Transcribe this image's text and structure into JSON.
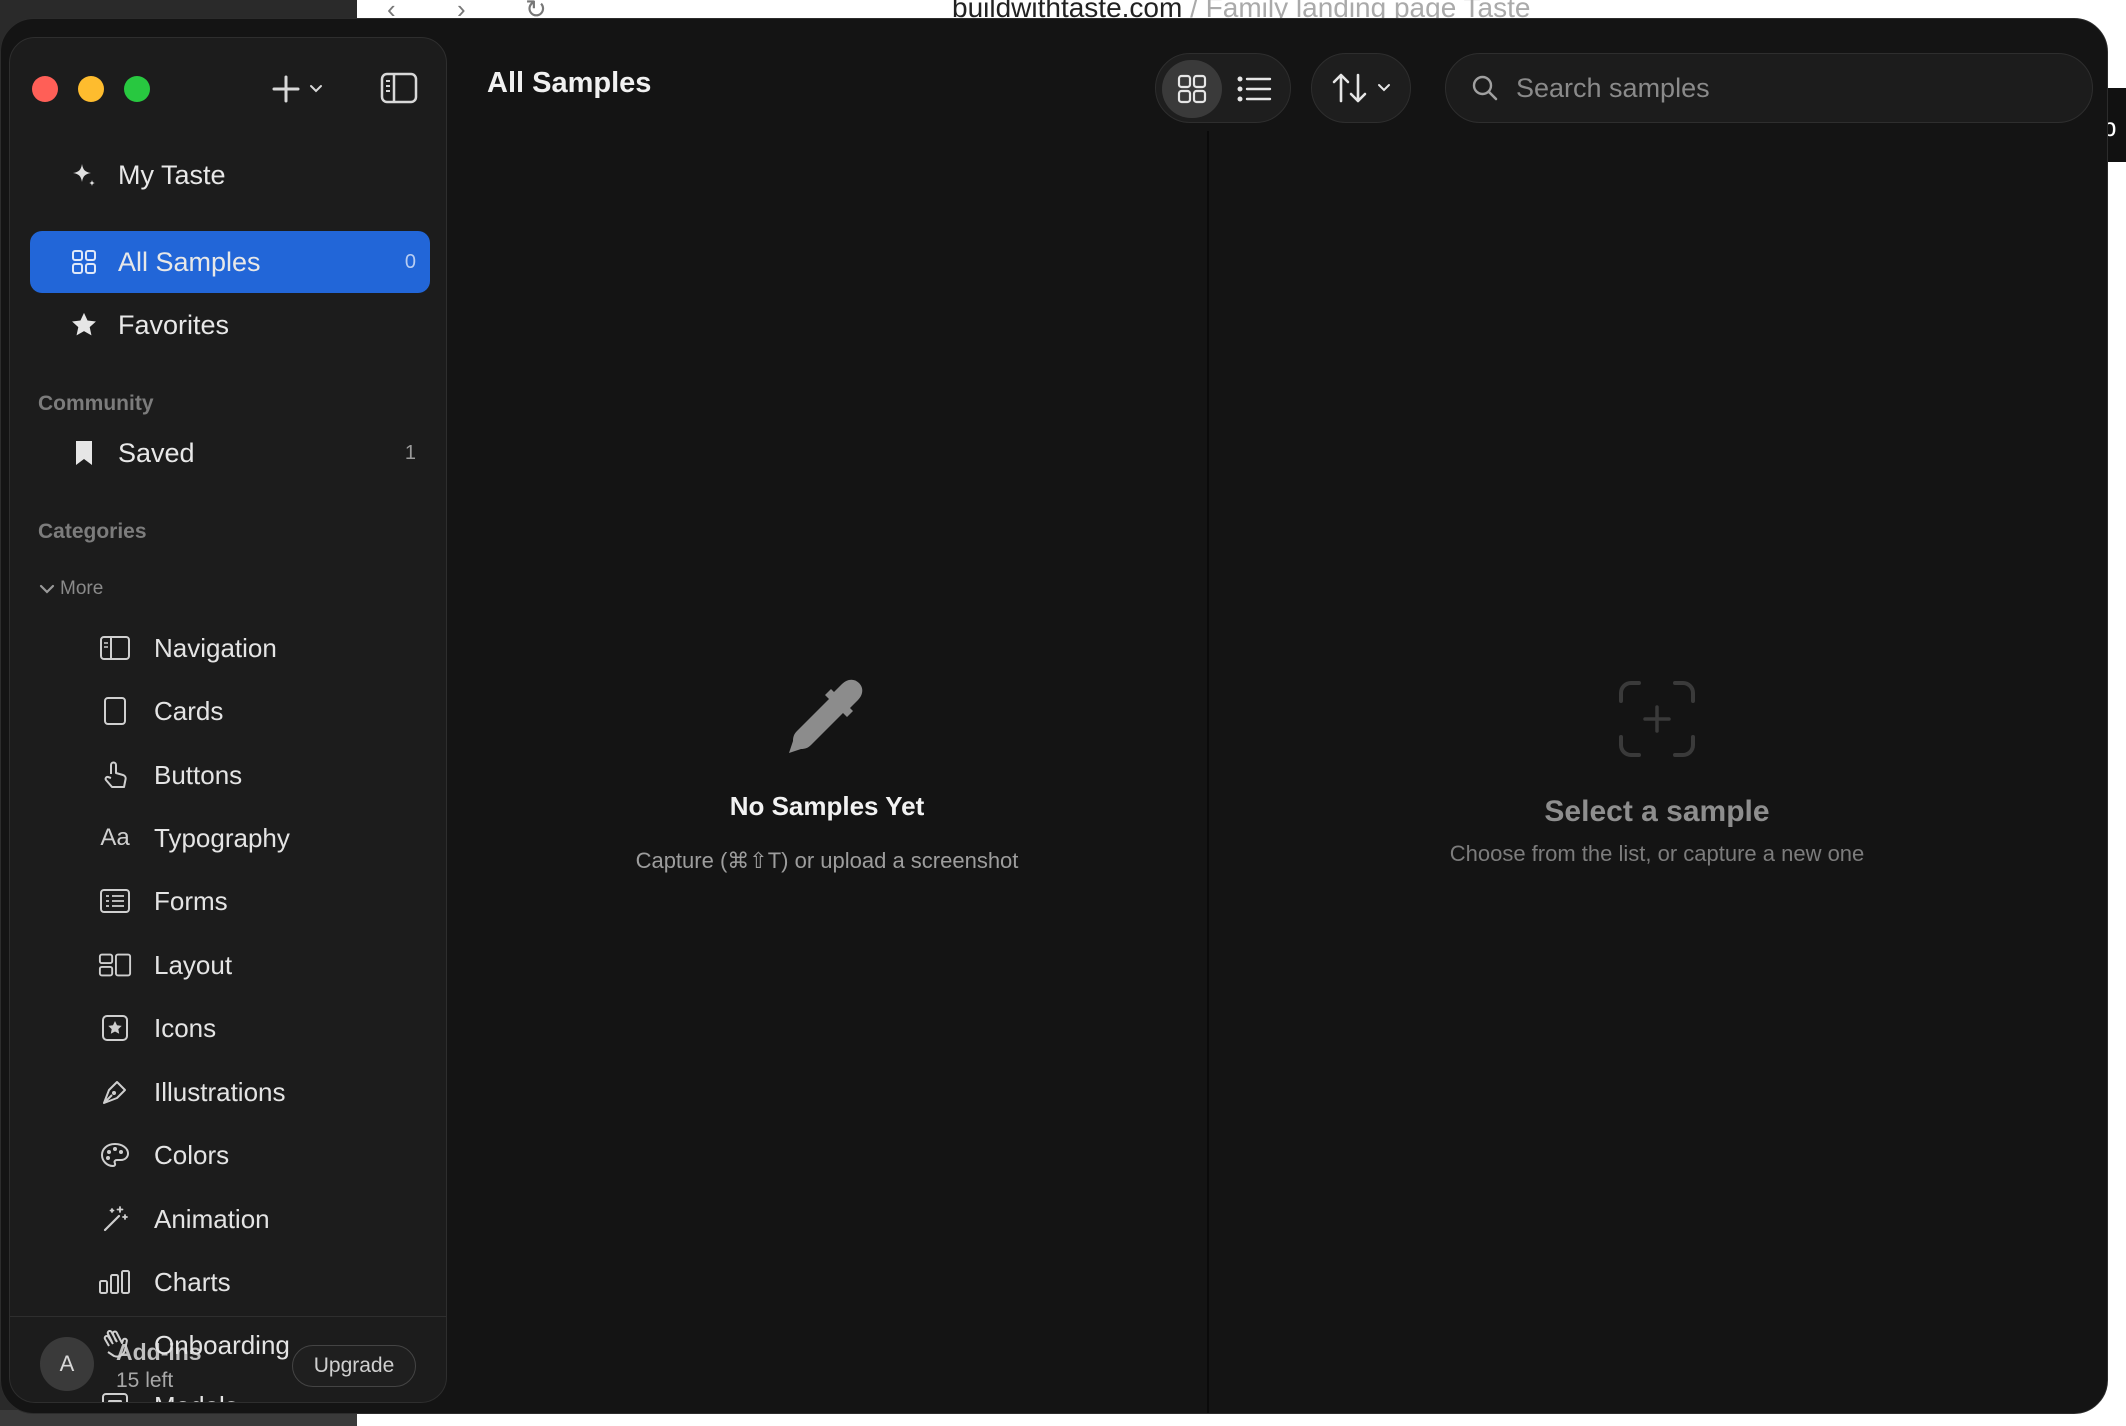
{
  "background": {
    "url_host": "buildwithtaste.com",
    "url_rest": " / Family landing page Taste",
    "edge_tab_text": "p"
  },
  "colors": {
    "accent": "#2266d8",
    "window_bg": "#141414",
    "sidebar_bg": "#1c1c1c",
    "traffic_red": "#ff5f57",
    "traffic_yellow": "#febc2e",
    "traffic_green": "#28c840"
  },
  "sidebar": {
    "top_items": [
      {
        "label": "My Taste",
        "icon": "sparkle-icon"
      },
      {
        "label": "All Samples",
        "icon": "grid-icon",
        "count": "0",
        "active": true
      },
      {
        "label": "Favorites",
        "icon": "star-icon"
      }
    ],
    "community_label": "Community",
    "community_items": [
      {
        "label": "Saved",
        "icon": "bookmark-icon",
        "count": "1"
      }
    ],
    "categories_label": "Categories",
    "more_label": "More",
    "categories": [
      {
        "label": "Navigation",
        "icon": "sidebar-layout-icon"
      },
      {
        "label": "Cards",
        "icon": "card-icon"
      },
      {
        "label": "Buttons",
        "icon": "pointer-hand-icon"
      },
      {
        "label": "Typography",
        "icon": "text-aa-icon"
      },
      {
        "label": "Forms",
        "icon": "form-list-icon"
      },
      {
        "label": "Layout",
        "icon": "layout-icon"
      },
      {
        "label": "Icons",
        "icon": "star-square-icon"
      },
      {
        "label": "Illustrations",
        "icon": "pen-nib-icon"
      },
      {
        "label": "Colors",
        "icon": "palette-icon"
      },
      {
        "label": "Animation",
        "icon": "magic-wand-icon"
      },
      {
        "label": "Charts",
        "icon": "bar-chart-icon"
      },
      {
        "label": "Onboarding",
        "icon": "waving-hand-icon"
      },
      {
        "label": "Modals",
        "icon": "modal-window-icon"
      }
    ],
    "footer": {
      "avatar_initial": "A",
      "plan_name": "Add-ins",
      "remaining": "15 left",
      "upgrade_label": "Upgrade"
    }
  },
  "toolbar": {
    "title": "All Samples",
    "view_mode": "grid",
    "search_placeholder": "Search samples"
  },
  "empty_state": {
    "title": "No Samples Yet",
    "subtitle": "Capture (⌘⇧T) or upload a screenshot"
  },
  "detail_placeholder": {
    "title": "Select a sample",
    "subtitle": "Choose from the list, or capture a new one"
  }
}
